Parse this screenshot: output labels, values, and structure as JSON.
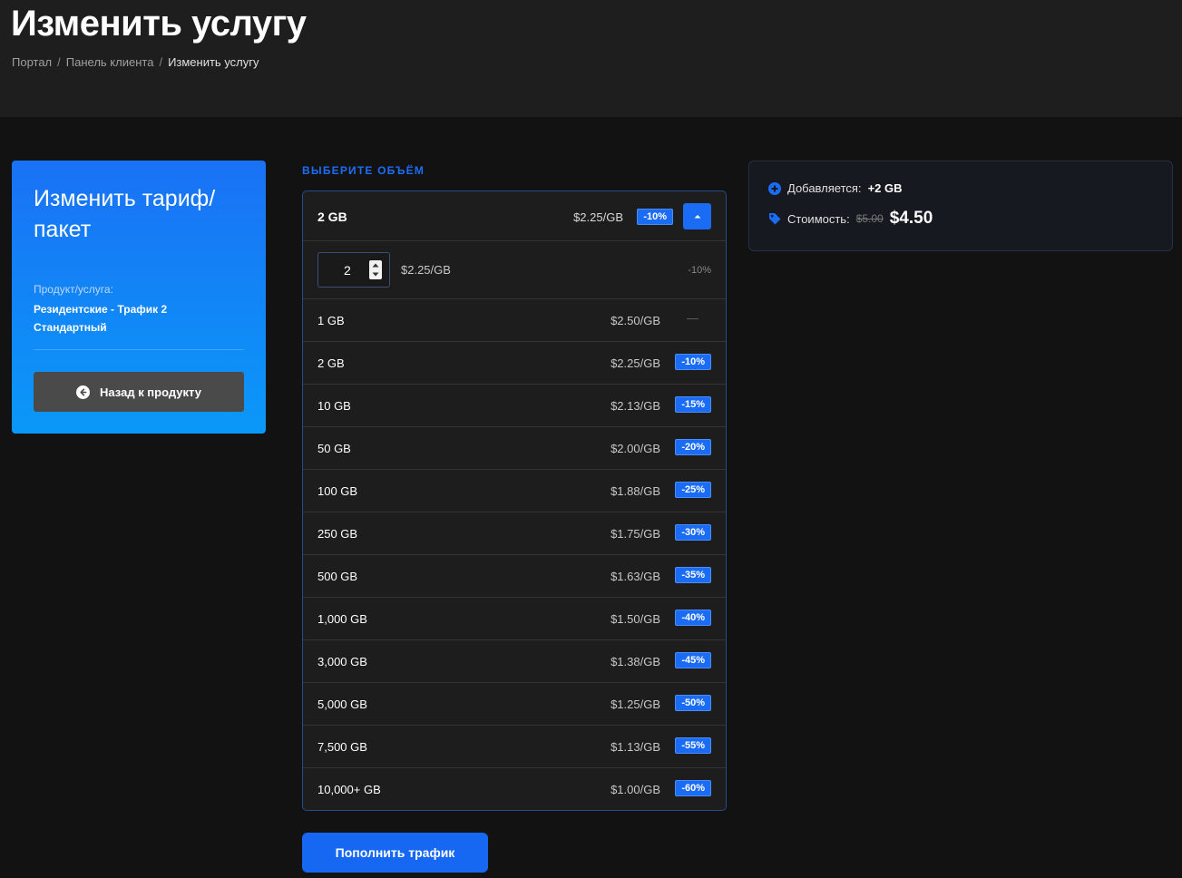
{
  "page": {
    "title": "Изменить услугу",
    "breadcrumb": [
      "Портал",
      "Панель клиента",
      "Изменить услугу"
    ],
    "breadcrumb_sep": "/"
  },
  "left": {
    "title": "Изменить тариф/ пакет",
    "product_label": "Продукт/услуга:",
    "product_name": "Резидентские - Трафик 2 Стандартный",
    "back_label": "Назад к продукту",
    "back_icon": "arrow-left-circle-icon"
  },
  "volume": {
    "section_label": "ВЫБЕРИТЕ ОБЪЁМ",
    "selected": {
      "label": "2 GB",
      "price": "$2.25/GB",
      "badge": "-10%"
    },
    "stepper": {
      "value": "2",
      "price": "$2.25/GB",
      "discount": "-10%"
    },
    "options": [
      {
        "label": "1 GB",
        "price": "$2.50/GB",
        "badge": "—"
      },
      {
        "label": "2 GB",
        "price": "$2.25/GB",
        "badge": "-10%"
      },
      {
        "label": "10 GB",
        "price": "$2.13/GB",
        "badge": "-15%"
      },
      {
        "label": "50 GB",
        "price": "$2.00/GB",
        "badge": "-20%"
      },
      {
        "label": "100 GB",
        "price": "$1.88/GB",
        "badge": "-25%"
      },
      {
        "label": "250 GB",
        "price": "$1.75/GB",
        "badge": "-30%"
      },
      {
        "label": "500 GB",
        "price": "$1.63/GB",
        "badge": "-35%"
      },
      {
        "label": "1,000 GB",
        "price": "$1.50/GB",
        "badge": "-40%"
      },
      {
        "label": "3,000 GB",
        "price": "$1.38/GB",
        "badge": "-45%"
      },
      {
        "label": "5,000 GB",
        "price": "$1.25/GB",
        "badge": "-50%"
      },
      {
        "label": "7,500 GB",
        "price": "$1.13/GB",
        "badge": "-55%"
      },
      {
        "label": "10,000+ GB",
        "price": "$1.00/GB",
        "badge": "-60%"
      }
    ],
    "submit_label": "Пополнить трафик"
  },
  "summary": {
    "added_label": "Добавляется:",
    "added_value": "+2 GB",
    "cost_label": "Стоимость:",
    "old_price": "$5.00",
    "new_price": "$4.50",
    "added_icon": "plus-circle-icon",
    "cost_icon": "tag-icon"
  },
  "colors": {
    "accent": "#1a6cf5",
    "background": "#121212",
    "header": "#1e1e1e"
  }
}
